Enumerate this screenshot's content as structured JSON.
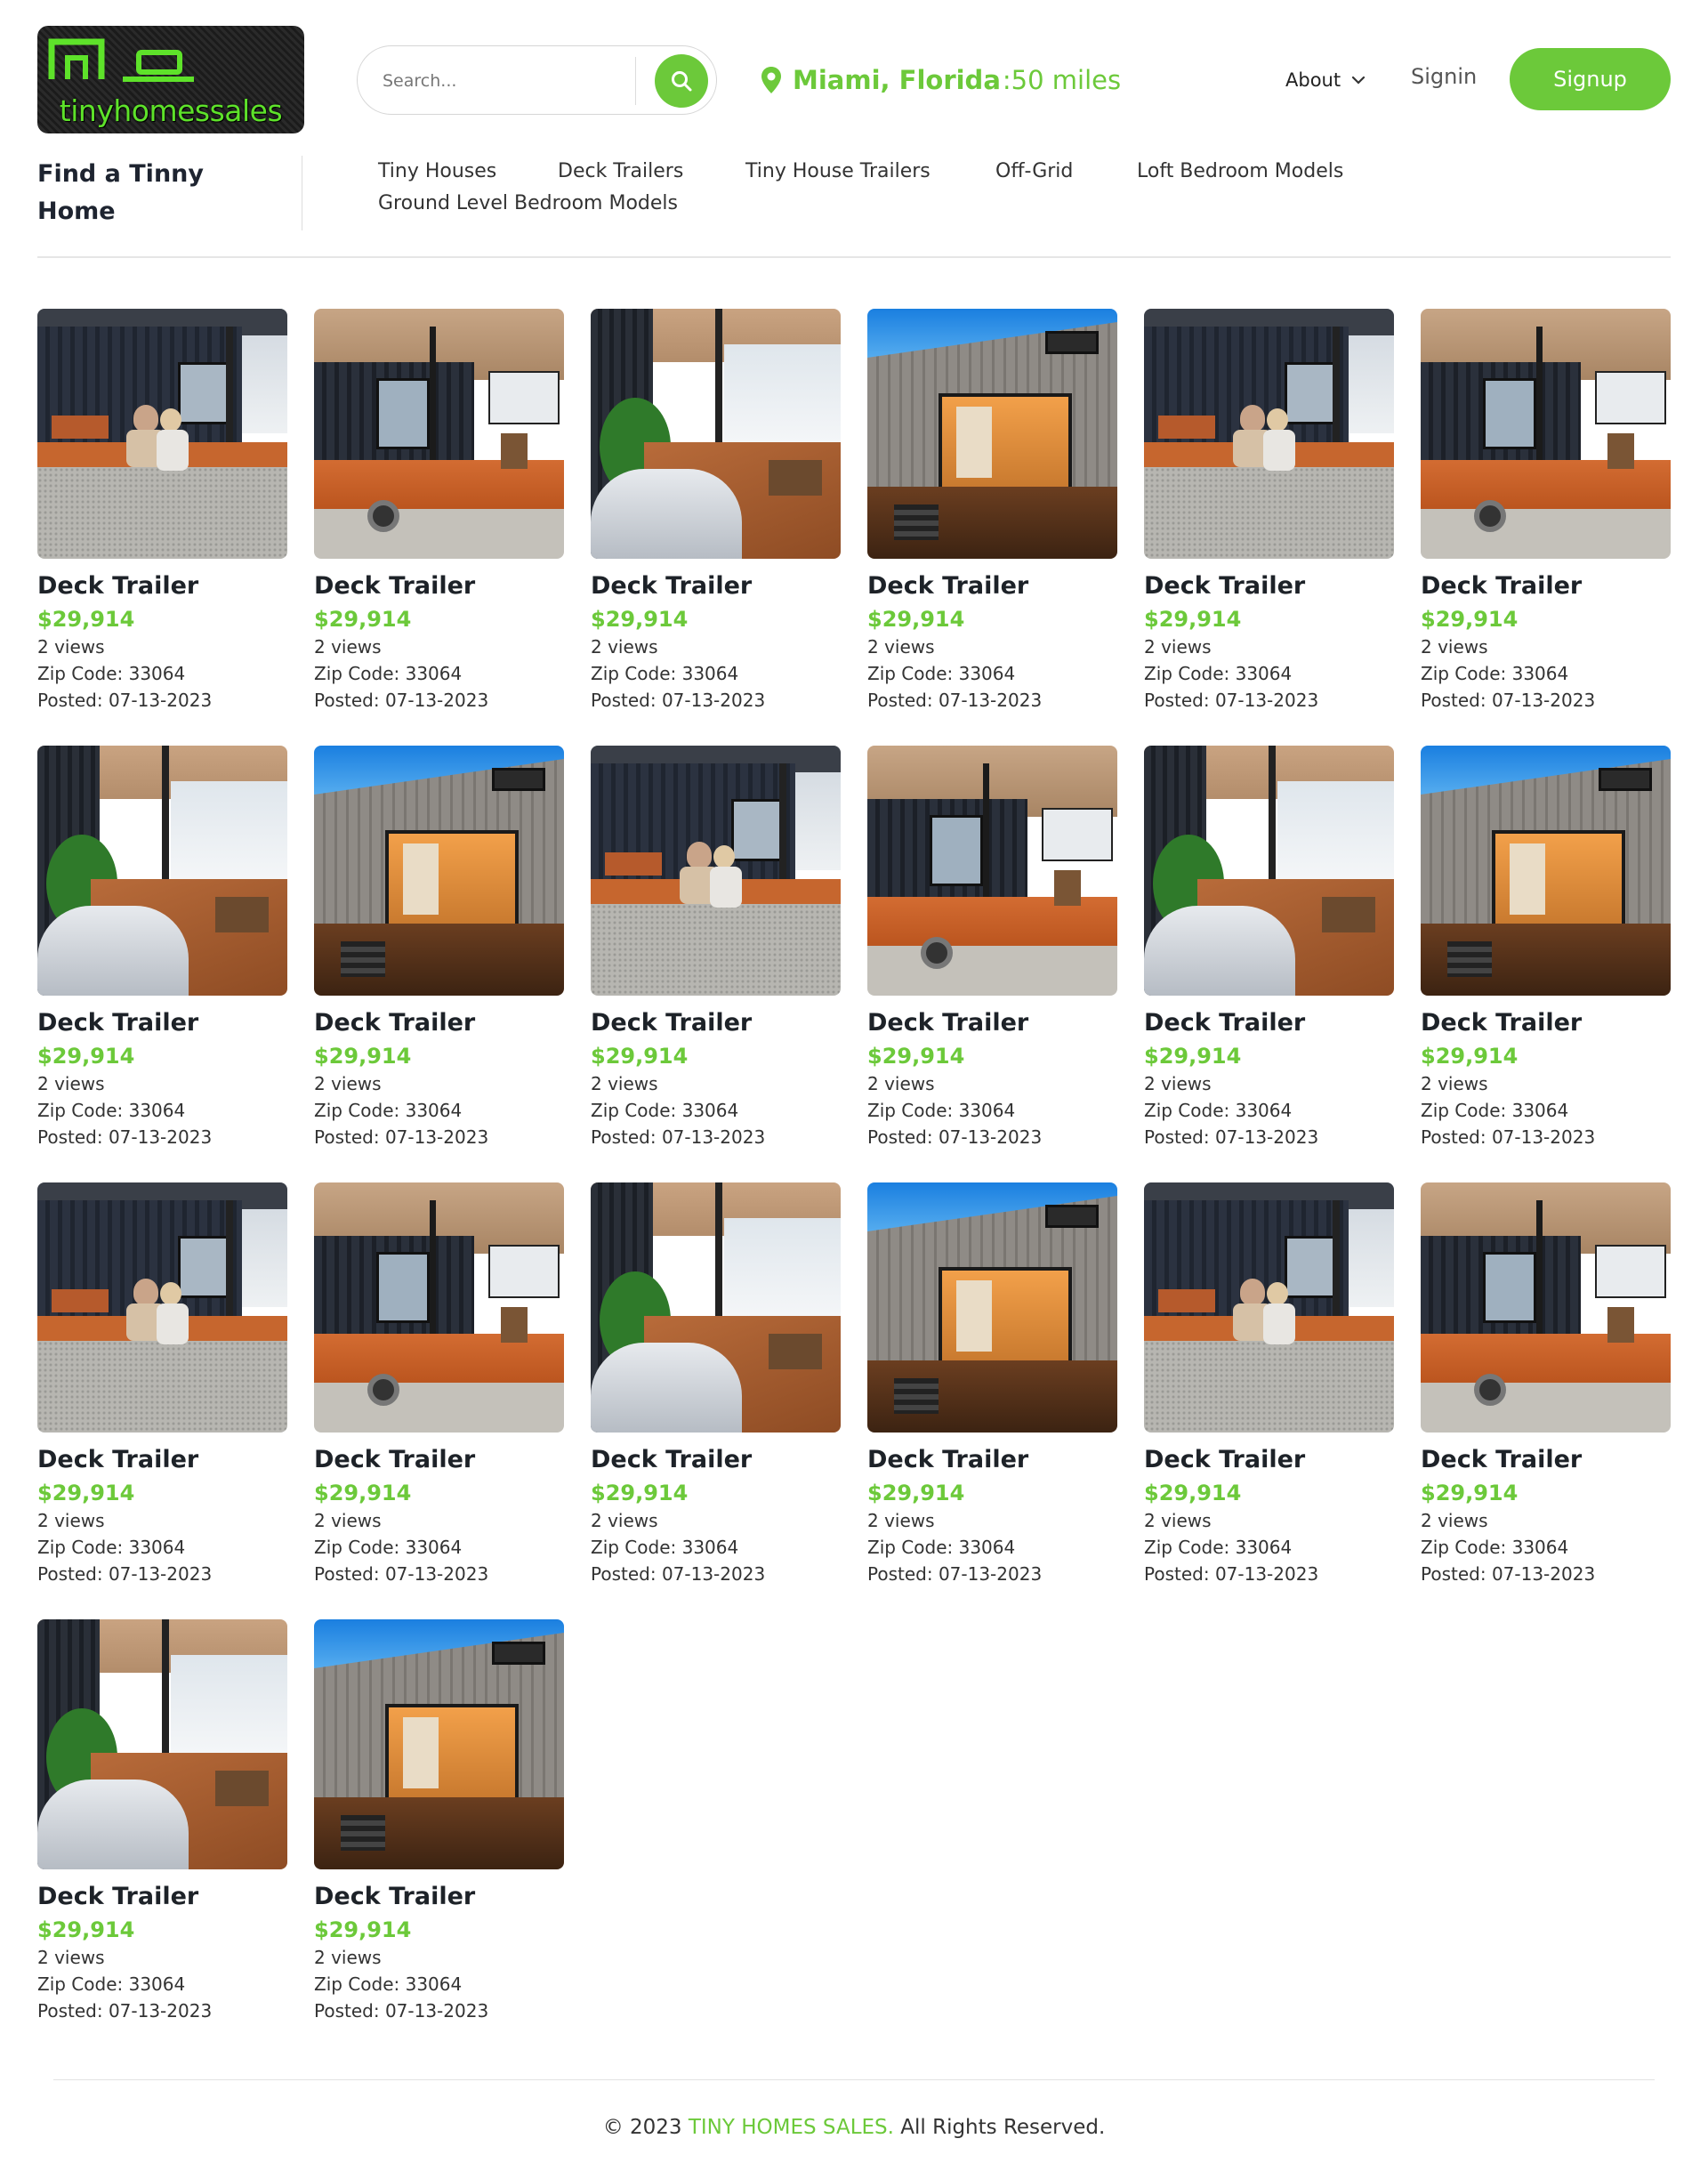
{
  "brand": {
    "logo_text": "tinyhomessales",
    "accent_color": "#6cc93a"
  },
  "search": {
    "placeholder": "Search...",
    "icon": "search-icon"
  },
  "location": {
    "city": "Miami, Florida",
    "radius": ":50 miles",
    "icon": "map-pin-icon"
  },
  "nav": {
    "about": "About",
    "signin": "Signin",
    "signup": "Signup"
  },
  "categories": {
    "title": "Find a Tinny Home",
    "items": [
      {
        "label": "Tiny Houses"
      },
      {
        "label": "Deck Trailers"
      },
      {
        "label": "Tiny House Trailers"
      },
      {
        "label": "Off-Grid"
      },
      {
        "label": "Loft Bedroom Models"
      },
      {
        "label": "Ground Level Bedroom Models"
      }
    ]
  },
  "listings": [
    {
      "title": "Deck Trailer",
      "price": "$29,914",
      "views": "2 views",
      "zip": "Zip Code: 33064",
      "posted": "Posted: 07-13-2023",
      "photo": "couple"
    },
    {
      "title": "Deck Trailer",
      "price": "$29,914",
      "views": "2 views",
      "zip": "Zip Code: 33064",
      "posted": "Posted: 07-13-2023",
      "photo": "deck"
    },
    {
      "title": "Deck Trailer",
      "price": "$29,914",
      "views": "2 views",
      "zip": "Zip Code: 33064",
      "posted": "Posted: 07-13-2023",
      "photo": "porch"
    },
    {
      "title": "Deck Trailer",
      "price": "$29,914",
      "views": "2 views",
      "zip": "Zip Code: 33064",
      "posted": "Posted: 07-13-2023",
      "photo": "front"
    },
    {
      "title": "Deck Trailer",
      "price": "$29,914",
      "views": "2 views",
      "zip": "Zip Code: 33064",
      "posted": "Posted: 07-13-2023",
      "photo": "couple"
    },
    {
      "title": "Deck Trailer",
      "price": "$29,914",
      "views": "2 views",
      "zip": "Zip Code: 33064",
      "posted": "Posted: 07-13-2023",
      "photo": "deck"
    },
    {
      "title": "Deck Trailer",
      "price": "$29,914",
      "views": "2 views",
      "zip": "Zip Code: 33064",
      "posted": "Posted: 07-13-2023",
      "photo": "porch"
    },
    {
      "title": "Deck Trailer",
      "price": "$29,914",
      "views": "2 views",
      "zip": "Zip Code: 33064",
      "posted": "Posted: 07-13-2023",
      "photo": "front"
    },
    {
      "title": "Deck Trailer",
      "price": "$29,914",
      "views": "2 views",
      "zip": "Zip Code: 33064",
      "posted": "Posted: 07-13-2023",
      "photo": "couple"
    },
    {
      "title": "Deck Trailer",
      "price": "$29,914",
      "views": "2 views",
      "zip": "Zip Code: 33064",
      "posted": "Posted: 07-13-2023",
      "photo": "deck"
    },
    {
      "title": "Deck Trailer",
      "price": "$29,914",
      "views": "2 views",
      "zip": "Zip Code: 33064",
      "posted": "Posted: 07-13-2023",
      "photo": "porch"
    },
    {
      "title": "Deck Trailer",
      "price": "$29,914",
      "views": "2 views",
      "zip": "Zip Code: 33064",
      "posted": "Posted: 07-13-2023",
      "photo": "front"
    },
    {
      "title": "Deck Trailer",
      "price": "$29,914",
      "views": "2 views",
      "zip": "Zip Code: 33064",
      "posted": "Posted: 07-13-2023",
      "photo": "couple"
    },
    {
      "title": "Deck Trailer",
      "price": "$29,914",
      "views": "2 views",
      "zip": "Zip Code: 33064",
      "posted": "Posted: 07-13-2023",
      "photo": "deck"
    },
    {
      "title": "Deck Trailer",
      "price": "$29,914",
      "views": "2 views",
      "zip": "Zip Code: 33064",
      "posted": "Posted: 07-13-2023",
      "photo": "porch"
    },
    {
      "title": "Deck Trailer",
      "price": "$29,914",
      "views": "2 views",
      "zip": "Zip Code: 33064",
      "posted": "Posted: 07-13-2023",
      "photo": "front"
    },
    {
      "title": "Deck Trailer",
      "price": "$29,914",
      "views": "2 views",
      "zip": "Zip Code: 33064",
      "posted": "Posted: 07-13-2023",
      "photo": "couple"
    },
    {
      "title": "Deck Trailer",
      "price": "$29,914",
      "views": "2 views",
      "zip": "Zip Code: 33064",
      "posted": "Posted: 07-13-2023",
      "photo": "deck"
    },
    {
      "title": "Deck Trailer",
      "price": "$29,914",
      "views": "2 views",
      "zip": "Zip Code: 33064",
      "posted": "Posted: 07-13-2023",
      "photo": "porch"
    },
    {
      "title": "Deck Trailer",
      "price": "$29,914",
      "views": "2 views",
      "zip": "Zip Code: 33064",
      "posted": "Posted: 07-13-2023",
      "photo": "front"
    }
  ],
  "footer": {
    "prefix": "© 2023 ",
    "brand": "TINY HOMES SALES.",
    "suffix": " All Rights Reserved."
  }
}
